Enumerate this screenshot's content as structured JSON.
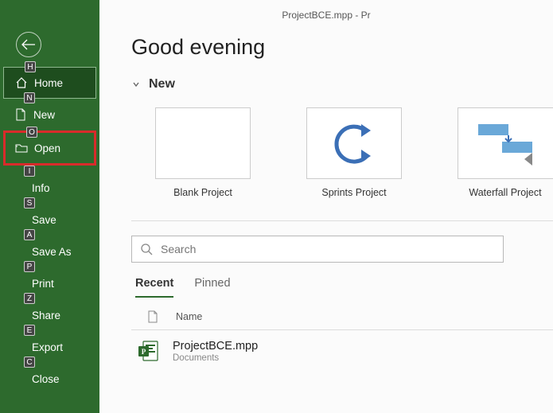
{
  "titlebar": "ProjectBCE.mpp  -  Pr",
  "greeting": "Good evening",
  "nav": {
    "home": {
      "label": "Home",
      "key": "H"
    },
    "new": {
      "label": "New",
      "key": "N"
    },
    "open": {
      "label": "Open",
      "key": "O"
    },
    "info": {
      "label": "Info",
      "key": "I"
    },
    "save": {
      "label": "Save",
      "key": "S"
    },
    "saveas": {
      "label": "Save As",
      "key": "A"
    },
    "print": {
      "label": "Print",
      "key": "P"
    },
    "share": {
      "label": "Share",
      "key": "Z"
    },
    "export": {
      "label": "Export",
      "key": "E"
    },
    "close": {
      "label": "Close",
      "key": "C"
    }
  },
  "section_new": "New",
  "templates": [
    {
      "label": "Blank Project"
    },
    {
      "label": "Sprints Project"
    },
    {
      "label": "Waterfall Project"
    }
  ],
  "search": {
    "placeholder": "Search"
  },
  "tabs": {
    "recent": "Recent",
    "pinned": "Pinned"
  },
  "filelist": {
    "header_name": "Name",
    "rows": [
      {
        "name": "ProjectBCE.mpp",
        "location": "Documents"
      }
    ]
  }
}
